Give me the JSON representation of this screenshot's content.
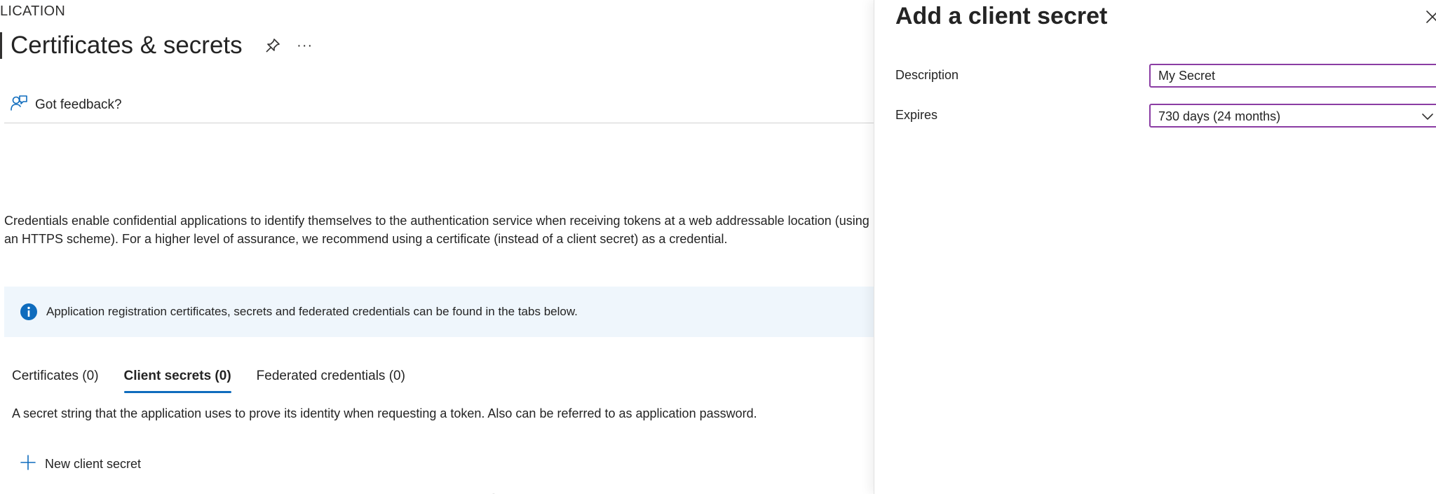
{
  "breadcrumb": "LICATION",
  "page": {
    "title": "Certificates & secrets",
    "more_glyph": "···"
  },
  "toolbar": {
    "feedback_label": "Got feedback?"
  },
  "description": "Credentials enable confidential applications to identify themselves to the authentication service when receiving tokens at a web addressable location (using an HTTPS scheme). For a higher level of assurance, we recommend using a certificate (instead of a client secret) as a credential.",
  "info_banner": {
    "text": "Application registration certificates, secrets and federated credentials can be found in the tabs below."
  },
  "tabs": [
    {
      "label": "Certificates (0)",
      "active": false
    },
    {
      "label": "Client secrets (0)",
      "active": true
    },
    {
      "label": "Federated credentials (0)",
      "active": false
    }
  ],
  "tab_description": "A secret string that the application uses to prove its identity when requesting a token. Also can be referred to as application password.",
  "new_secret_label": "New client secret",
  "panel": {
    "title": "Add a client secret",
    "description_label": "Description",
    "description_value": "My Secret",
    "expires_label": "Expires",
    "expires_value": "730 days (24 months)"
  },
  "colors": {
    "accent_blue": "#0f6cbd",
    "info_background": "#eff6fc",
    "focus_border": "#8a3ca3"
  }
}
